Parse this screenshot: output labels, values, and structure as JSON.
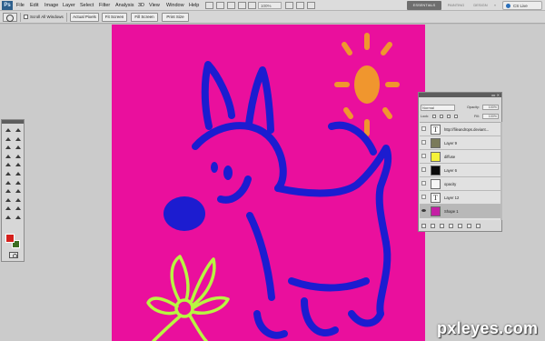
{
  "app": {
    "logo_text": "Ps"
  },
  "menubar": {
    "menus": [
      "File",
      "Edit",
      "Image",
      "Layer",
      "Select",
      "Filter",
      "Analysis",
      "3D",
      "View",
      "Window",
      "Help"
    ],
    "zoom": "100%",
    "workspaces": [
      "ESSENTIALS",
      "PAINTING",
      "DESIGN",
      "»"
    ],
    "active_workspace": "ESSENTIALS",
    "cs_live": "CS Live"
  },
  "options_bar": {
    "scroll_all_windows_label": "Scroll All Windows",
    "scroll_all_windows_checked": false,
    "buttons": [
      "Actual Pixels",
      "Fit Screen",
      "Fill Screen",
      "Print Size"
    ]
  },
  "canvas": {
    "background_color": "#ea0f9d",
    "dog_stroke_color": "#1c1cd0",
    "sun_color": "#f0962e",
    "flower_color": "#b8f542"
  },
  "toolbox": {
    "foreground_color": "#d4211d",
    "background_color": "#3c6e22",
    "tools": [
      "move-tool",
      "marquee-tool",
      "lasso-tool",
      "quick-selection-tool",
      "crop-tool",
      "eyedropper-tool",
      "spot-healing-tool",
      "brush-tool",
      "clone-stamp-tool",
      "history-brush-tool",
      "eraser-tool",
      "gradient-tool",
      "blur-tool",
      "dodge-tool",
      "pen-tool",
      "type-tool",
      "path-selection-tool",
      "shape-tool",
      "3d-rotate-tool",
      "3d-orbit-tool",
      "hand-tool",
      "zoom-tool"
    ]
  },
  "layers_panel": {
    "blend_mode": "Normal",
    "opacity_label": "Opacity:",
    "opacity": "100%",
    "fill_label": "Fill:",
    "fill": "100%",
    "lock_label": "Lock:",
    "layers": [
      {
        "name": "http://fileandrops.deviant...",
        "type": "text",
        "visible": false,
        "thumb_color": ""
      },
      {
        "name": "Layer 9",
        "type": "image",
        "visible": false,
        "thumb_color": "#7a7a5a"
      },
      {
        "name": "diffuse",
        "type": "fill",
        "visible": false,
        "thumb_color": "#f5f23a"
      },
      {
        "name": "Layer 6",
        "type": "fill",
        "visible": false,
        "thumb_color": "#0a0a0a"
      },
      {
        "name": "opacity",
        "type": "fill",
        "visible": false,
        "thumb_color": "#f6f6f6"
      },
      {
        "name": "Layer 12",
        "type": "text",
        "visible": false,
        "thumb_color": ""
      },
      {
        "name": "Shape 1",
        "type": "fill",
        "visible": true,
        "thumb_color": "#c41fa4"
      }
    ]
  },
  "watermark": "pxleyes.com"
}
